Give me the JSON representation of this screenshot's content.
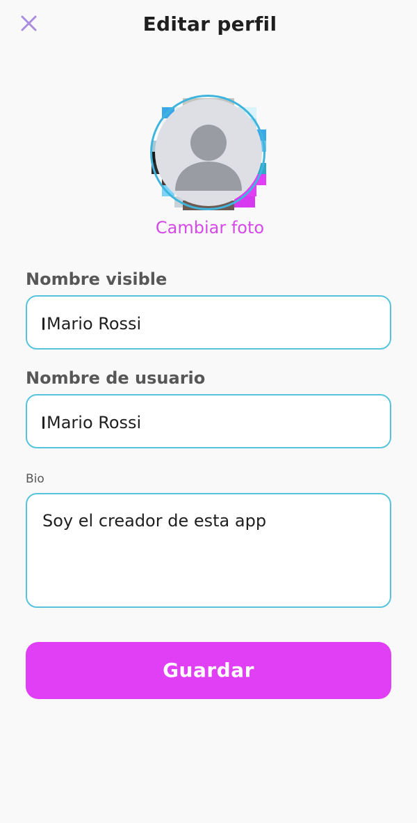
{
  "header": {
    "title": "Editar perfil",
    "close_icon": "close-icon",
    "close_color": "#a98ce0"
  },
  "avatar": {
    "icon": "person-placeholder-icon",
    "change_photo_label": "Cambiar foto",
    "ring_color": "#3fb4dc"
  },
  "form": {
    "display_name": {
      "label": "Nombre visible",
      "value": "Mario Rossi"
    },
    "username": {
      "label": "Nombre de usuario",
      "value": "Mario Rossi"
    },
    "bio": {
      "label": "Bio",
      "value": "Soy el creador de esta app"
    }
  },
  "actions": {
    "save_label": "Guardar"
  },
  "colors": {
    "accent": "#e03ff5",
    "link": "#d44ae6",
    "input_border": "#55c3dc",
    "background": "#f9f9f9"
  }
}
